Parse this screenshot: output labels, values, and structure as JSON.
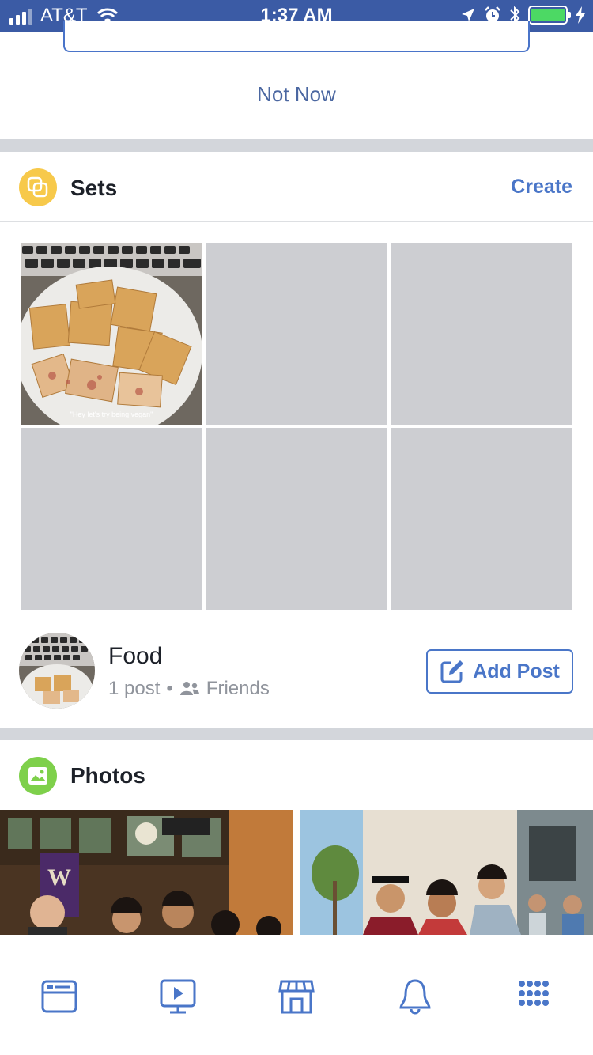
{
  "status_bar": {
    "carrier": "AT&T",
    "time": "1:37 AM",
    "battery_color": "#4cd964"
  },
  "not_now": "Not Now",
  "sets": {
    "title": "Sets",
    "create_label": "Create",
    "icon": "sets-icon",
    "icon_color": "#f7c94b",
    "cells": [
      {
        "type": "photo",
        "caption": "\"Hey let's try being vegan\""
      },
      {
        "type": "empty"
      },
      {
        "type": "empty"
      },
      {
        "type": "empty"
      },
      {
        "type": "empty"
      },
      {
        "type": "empty"
      }
    ],
    "set": {
      "name": "Food",
      "post_count": "1 post",
      "audience": "Friends",
      "add_post_label": "Add Post"
    }
  },
  "photos": {
    "title": "Photos",
    "icon": "photo-icon",
    "icon_color": "#7ed04b"
  },
  "tabs": [
    {
      "name": "news-feed",
      "icon": "news-feed-icon"
    },
    {
      "name": "watch",
      "icon": "video-icon"
    },
    {
      "name": "marketplace",
      "icon": "marketplace-icon"
    },
    {
      "name": "notifications",
      "icon": "bell-icon"
    },
    {
      "name": "menu",
      "icon": "menu-grid-icon"
    }
  ],
  "colors": {
    "brand": "#3b5ba5",
    "accent": "#4a76c8",
    "placeholder": "#cdced2"
  }
}
